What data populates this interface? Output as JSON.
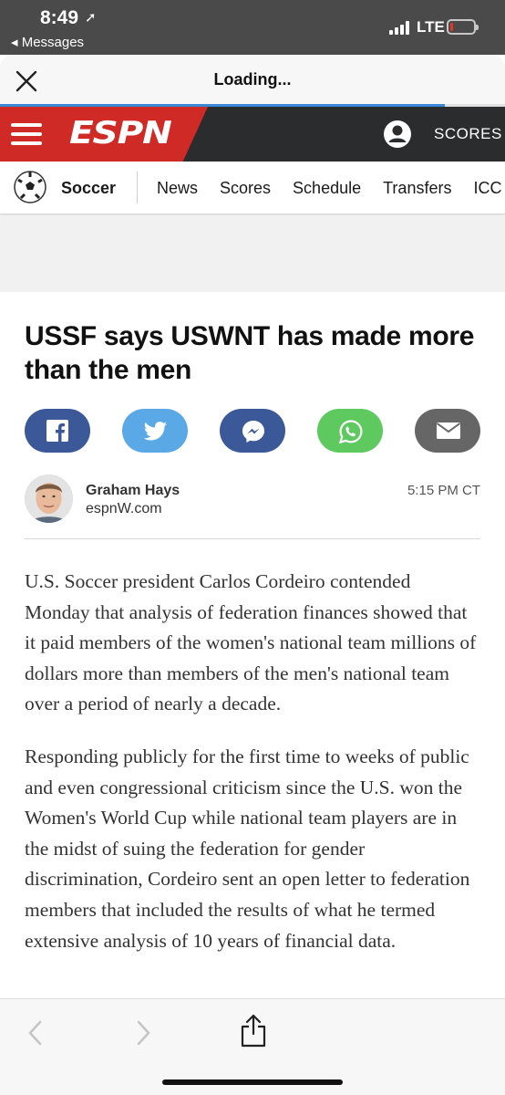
{
  "status": {
    "time": "8:49",
    "location_glyph": "➚",
    "back_label": "◂ Messages",
    "network": "LTE",
    "battery_level": 0.12,
    "battery_color": "#e3362b"
  },
  "browser": {
    "title": "Loading...",
    "close_icon": "close-icon",
    "progress": 0.88,
    "progress_color": "#3a86d8"
  },
  "header": {
    "logo": "ESPN",
    "scores_label": "SCORES",
    "brand_color": "#cf2a26"
  },
  "sport_nav": {
    "sport": "Soccer",
    "items": [
      "News",
      "Scores",
      "Schedule",
      "Transfers",
      "ICC"
    ]
  },
  "article": {
    "headline": "USSF says USWNT has made more than the men",
    "share": [
      {
        "name": "facebook",
        "color": "#3b5998"
      },
      {
        "name": "twitter",
        "color": "#5aa9e6"
      },
      {
        "name": "messenger",
        "color": "#3b5998"
      },
      {
        "name": "whatsapp",
        "color": "#5ec95e"
      },
      {
        "name": "email",
        "color": "#666666"
      }
    ],
    "author": "Graham Hays",
    "source": "espnW.com",
    "timestamp": "5:15 PM CT",
    "paragraphs": [
      "U.S. Soccer president Carlos Cordeiro contended Monday that analysis of federation finances showed that it paid members of the women's national team millions of dollars more than members of the men's national team over a period of nearly a decade.",
      "Responding publicly for the first time to weeks of public and even congressional criticism since the U.S. won the Women's World Cup while national team players are in the midst of suing the federation for gender discrimination, Cordeiro sent an open letter to federation members that included the results of what he termed extensive analysis of 10 years of financial data."
    ]
  }
}
